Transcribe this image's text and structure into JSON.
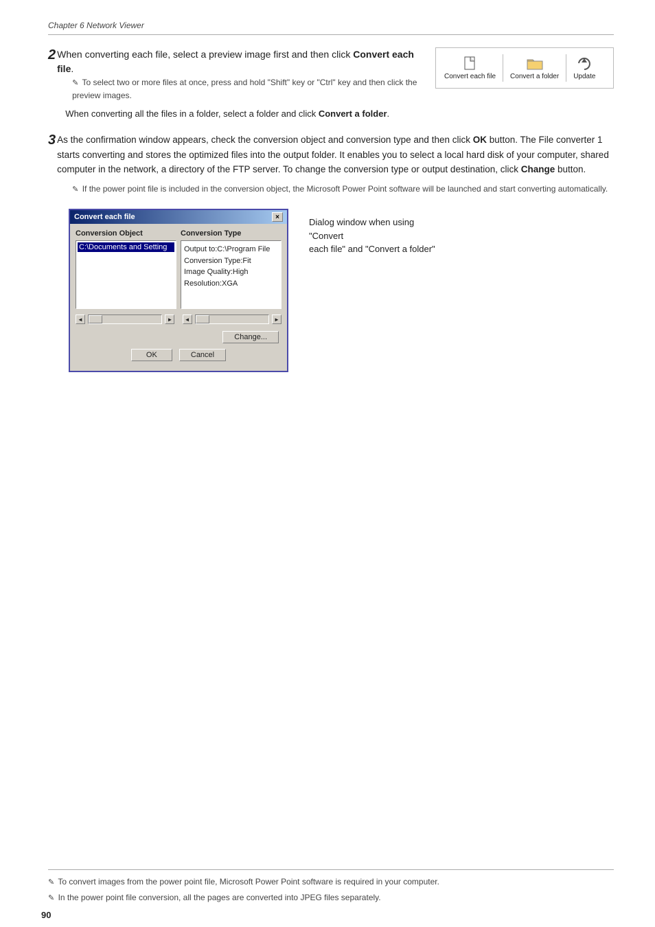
{
  "chapter": {
    "title": "Chapter 6 Network Viewer"
  },
  "page_number": "90",
  "step2": {
    "number": "2",
    "main_text": "When converting each file, select a preview image first and then click ",
    "main_bold": "Convert each file",
    "main_period": ".",
    "note1_icon": "✎",
    "note1_text": "To select two or more files at once, press and hold \"Shift\" key or \"Ctrl\" key and then click the preview images.",
    "paragraph_start": "When converting all the files in a folder, select a folder and click ",
    "paragraph_bold": "Convert a folder",
    "paragraph_end": ".",
    "toolbar": {
      "item1_label": "Convert each file",
      "item2_label": "Convert a folder",
      "item3_label": "Update"
    }
  },
  "step3": {
    "number": "3",
    "text_before_ok": "As the confirmation window appears, check the conversion object and conversion type and then click ",
    "ok_bold": "OK",
    "text_after_ok": " button. The File converter 1 starts converting and stores the optimized files into the output folder. It enables you to select a local hard disk of your computer, shared computer in the network, a directory of the FTP server. To change the conversion type or output destination, click ",
    "change_bold": "Change",
    "text_end": " button.",
    "note_icon": "✎",
    "note_text": "If the power point file is included in the conversion object, the Microsoft Power Point software will be launched and start converting automatically."
  },
  "dialog": {
    "title": "Convert each file",
    "close_btn": "×",
    "col1_header": "Conversion Object",
    "col1_item": "C:\\Documents and Setting",
    "col2_header": "Conversion Type",
    "col2_line1": "Output to:C:\\Program File",
    "col2_line2": "Conversion Type:Fit",
    "col2_line3": "Image Quality:High",
    "col2_line4": "Resolution:XGA",
    "change_btn": "Change...",
    "ok_btn": "OK",
    "cancel_btn": "Cancel",
    "caption_line1": "Dialog window when using \"Convert",
    "caption_line2": "each file\" and \"Convert a folder\""
  },
  "footer": {
    "note1_icon": "✎",
    "note1_text": "To convert images from the power point file, Microsoft Power Point software is required in your computer.",
    "note2_icon": "✎",
    "note2_text": "In the power point file conversion, all the pages are converted into JPEG files separately."
  }
}
